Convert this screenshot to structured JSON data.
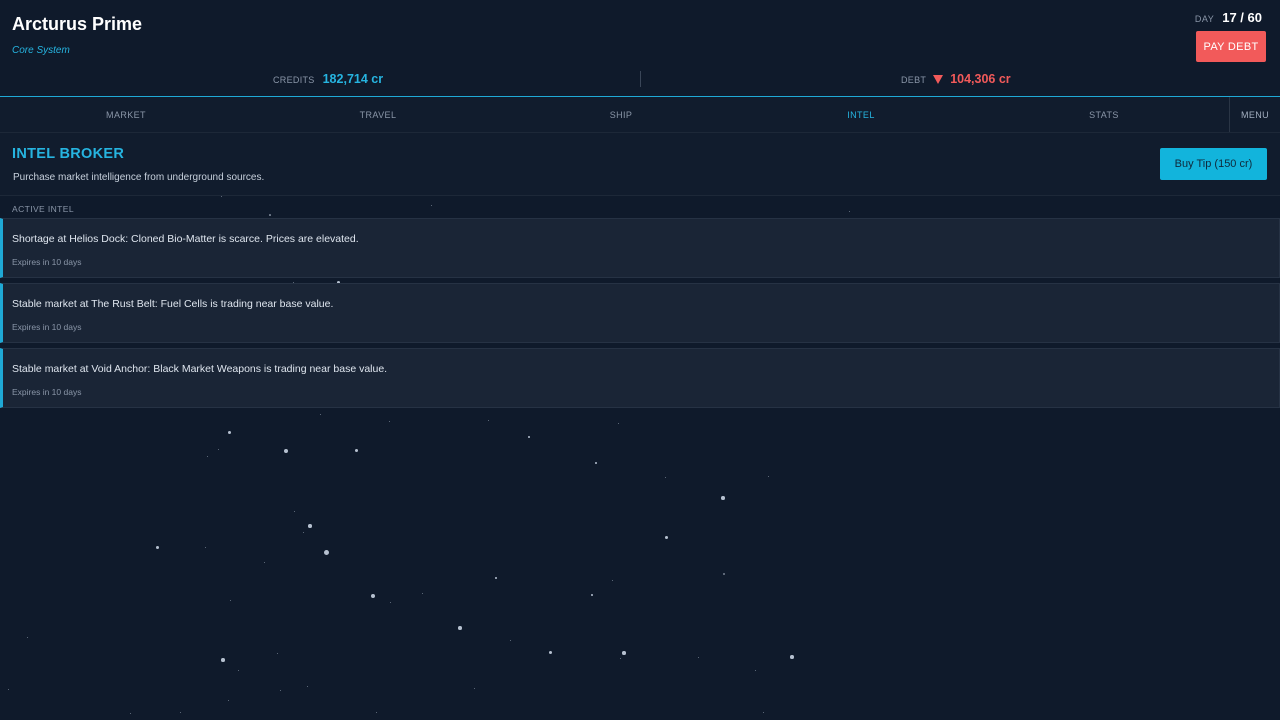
{
  "location": {
    "name": "Arcturus Prime",
    "system": "Core System"
  },
  "day": {
    "label": "DAY",
    "value": "17 / 60"
  },
  "actions": {
    "pay_debt": "PAY DEBT"
  },
  "finances": {
    "credits_label": "CREDITS",
    "credits_value": "182,714 cr",
    "debt_label": "DEBT",
    "debt_value": "104,306 cr",
    "debt_trend_icon": "triangle-down-icon"
  },
  "nav": {
    "tabs": [
      {
        "label": "MARKET",
        "active": false
      },
      {
        "label": "TRAVEL",
        "active": false
      },
      {
        "label": "SHIP",
        "active": false
      },
      {
        "label": "INTEL",
        "active": true
      },
      {
        "label": "STATS",
        "active": false
      }
    ],
    "menu": "MENU"
  },
  "broker": {
    "title": "INTEL BROKER",
    "description": "Purchase market intelligence from underground sources.",
    "buy_tip": "Buy Tip (150 cr)"
  },
  "intel": {
    "section_label": "ACTIVE INTEL",
    "items": [
      {
        "text": "Shortage at Helios Dock: Cloned Bio-Matter is scarce. Prices are elevated.",
        "expiry": "Expires in 10 days"
      },
      {
        "text": "Stable market at The Rust Belt: Fuel Cells is trading near base value.",
        "expiry": "Expires in 10 days"
      },
      {
        "text": "Stable market at Void Anchor: Black Market Weapons is trading near base value.",
        "expiry": "Expires in 10 days"
      }
    ]
  },
  "colors": {
    "background": "#0f1a2b",
    "accent": "#26b4e0",
    "danger": "#f25a5a",
    "card": "#1a2536"
  }
}
